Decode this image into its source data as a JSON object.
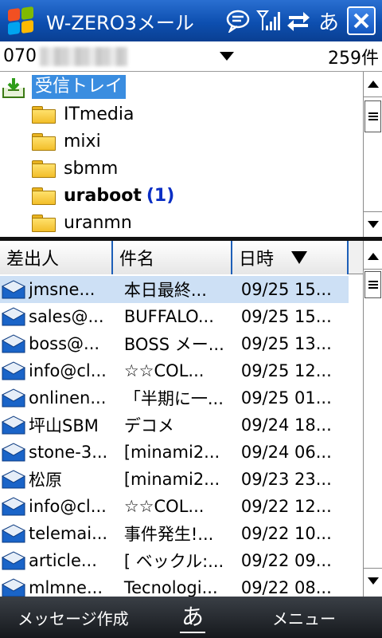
{
  "titlebar": {
    "title": "W-ZERO3メール",
    "ime_label": "あ",
    "icons": [
      "windows-logo",
      "message-bubble-icon",
      "signal-icon",
      "sync-arrows-icon",
      "close-icon"
    ]
  },
  "account": {
    "number_prefix": "070",
    "count_label": "259件"
  },
  "folders": {
    "inbox_label": "受信トレイ",
    "items": [
      {
        "name": "ITmedia",
        "unread": ""
      },
      {
        "name": "mixi",
        "unread": ""
      },
      {
        "name": "sbmm",
        "unread": ""
      },
      {
        "name": "uraboot",
        "unread": "(1)"
      },
      {
        "name": "uranmn",
        "unread": ""
      }
    ]
  },
  "columns": {
    "sender": "差出人",
    "subject": "件名",
    "date": "日時"
  },
  "messages": [
    {
      "sender": "jmsne...",
      "subject": "本日最終...",
      "date": "09/25 15..."
    },
    {
      "sender": "sales@...",
      "subject": "BUFFALO...",
      "date": "09/25 15..."
    },
    {
      "sender": "boss@...",
      "subject": "BOSS メー...",
      "date": "09/25 13..."
    },
    {
      "sender": "info@cl...",
      "subject": "☆☆COL...",
      "date": "09/25 12..."
    },
    {
      "sender": "onlinen...",
      "subject": "「半期に一...",
      "date": "09/25 01..."
    },
    {
      "sender": "坪山SBM",
      "subject": "デコメ",
      "date": "09/24 18..."
    },
    {
      "sender": "stone-3...",
      "subject": "[minami2...",
      "date": "09/24 06..."
    },
    {
      "sender": "松原",
      "subject": "[minami2...",
      "date": "09/23 23..."
    },
    {
      "sender": "info@cl...",
      "subject": "☆☆COL...",
      "date": "09/22 12..."
    },
    {
      "sender": "telemai...",
      "subject": "事件発生!...",
      "date": "09/22 10..."
    },
    {
      "sender": "article...",
      "subject": "[ ベックル:...",
      "date": "09/22 09..."
    },
    {
      "sender": "mlmne...",
      "subject": "Tecnologi...",
      "date": "09/22 08..."
    }
  ],
  "softkeys": {
    "left": "メッセージ作成",
    "center": "あ",
    "right": "メニュー"
  },
  "colors": {
    "titlebar": "#0d4fb0",
    "selection": "#3a8de0",
    "selected_row": "#cde0f5",
    "unread": "#0a2ec4"
  }
}
